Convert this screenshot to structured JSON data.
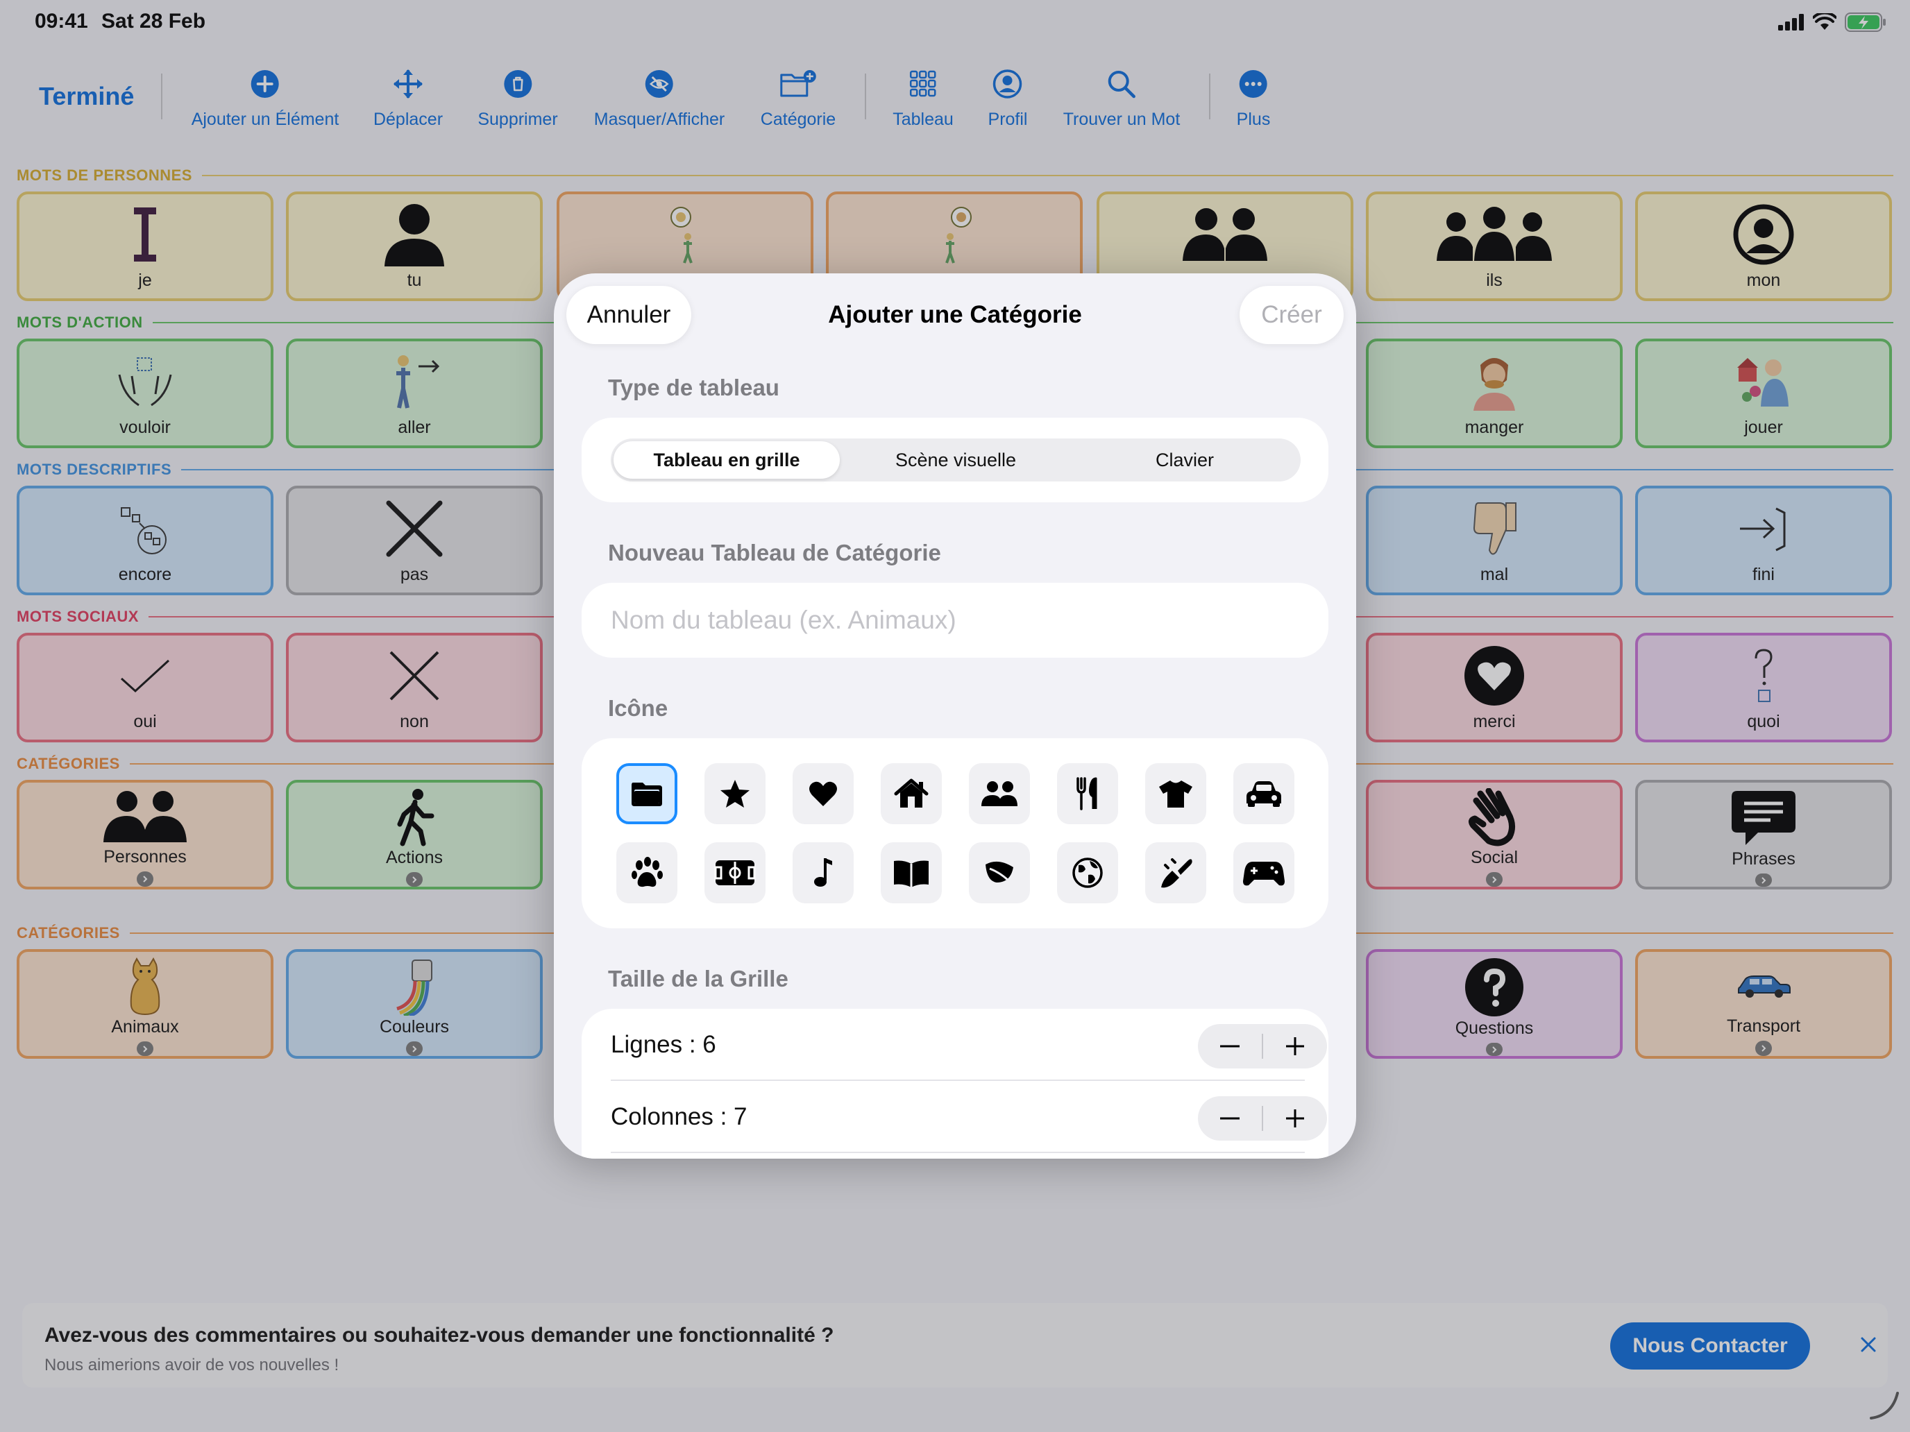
{
  "status_bar": {
    "time": "09:41",
    "date": "Sat 28 Feb"
  },
  "toolbar": {
    "done": "Terminé",
    "items": [
      {
        "label": "Ajouter un Élément",
        "icon": "plus-circle-icon"
      },
      {
        "label": "Déplacer",
        "icon": "move-arrows-icon"
      },
      {
        "label": "Supprimer",
        "icon": "trash-icon"
      },
      {
        "label": "Masquer/Afficher",
        "icon": "eye-slash-icon"
      },
      {
        "label": "Catégorie",
        "icon": "folder-plus-icon"
      },
      {
        "label": "Tableau",
        "icon": "grid-icon"
      },
      {
        "label": "Profil",
        "icon": "person-circle-icon"
      },
      {
        "label": "Trouver un Mot",
        "icon": "magnifier-icon"
      },
      {
        "label": "Plus",
        "icon": "ellipsis-circle-icon"
      }
    ]
  },
  "board": {
    "sections": [
      {
        "title": "MOTS DE PERSONNES",
        "color": "#d4a92a"
      },
      {
        "title": "MOTS D'ACTION",
        "color": "#3aa83a"
      },
      {
        "title": "MOTS DESCRIPTIFS",
        "color": "#3b8fe0"
      },
      {
        "title": "MOTS SOCIAUX",
        "color": "#e0385a"
      },
      {
        "title": "CATÉGORIES",
        "color": "#e8873a"
      },
      {
        "title": "CATÉGORIES",
        "color": "#e8873a"
      }
    ],
    "cells": {
      "je": "je",
      "tu": "tu",
      "ils": "ils",
      "mon": "mon",
      "vouloir": "vouloir",
      "aller": "aller",
      "manger": "manger",
      "jouer": "jouer",
      "encore": "encore",
      "pas": "pas",
      "mal": "mal",
      "fini": "fini",
      "oui": "oui",
      "non": "non",
      "merci": "merci",
      "quoi": "quoi",
      "personnes": "Personnes",
      "actions": "Actions",
      "social": "Social",
      "phrases": "Phrases",
      "animaux": "Animaux",
      "couleurs": "Couleurs",
      "questions": "Questions",
      "transport": "Transport"
    }
  },
  "modal": {
    "title": "Ajouter une Catégorie",
    "cancel": "Annuler",
    "create": "Créer",
    "board_type_label": "Type de tableau",
    "board_types": [
      "Tableau en grille",
      "Scène visuelle",
      "Clavier"
    ],
    "selected_board_type": "Tableau en grille",
    "new_board_label": "Nouveau Tableau de Catégorie",
    "name_placeholder": "Nom du tableau (ex. Animaux)",
    "name_value": "",
    "icon_label": "Icône",
    "icons": [
      "folder-icon",
      "star-icon",
      "heart-icon",
      "house-icon",
      "people-icon",
      "fork-knife-icon",
      "tshirt-icon",
      "car-icon",
      "paw-icon",
      "soccer-field-icon",
      "music-note-icon",
      "book-icon",
      "leaf-icon",
      "globe-icon",
      "paintbrush-icon",
      "gamecontroller-icon"
    ],
    "selected_icon": "folder-icon",
    "grid_size_label": "Taille de la Grille",
    "rows_text": "Lignes : 6",
    "cols_text": "Colonnes : 7",
    "rows": 6,
    "cols": 7
  },
  "banner": {
    "title": "Avez-vous des commentaires ou souhaitez-vous demander une fonctionnalité ?",
    "subtitle": "Nous aimerions avoir de vos nouvelles !",
    "button": "Nous Contacter"
  },
  "colors": {
    "accent": "#0a6bdc",
    "selection": "#1a8cff"
  }
}
